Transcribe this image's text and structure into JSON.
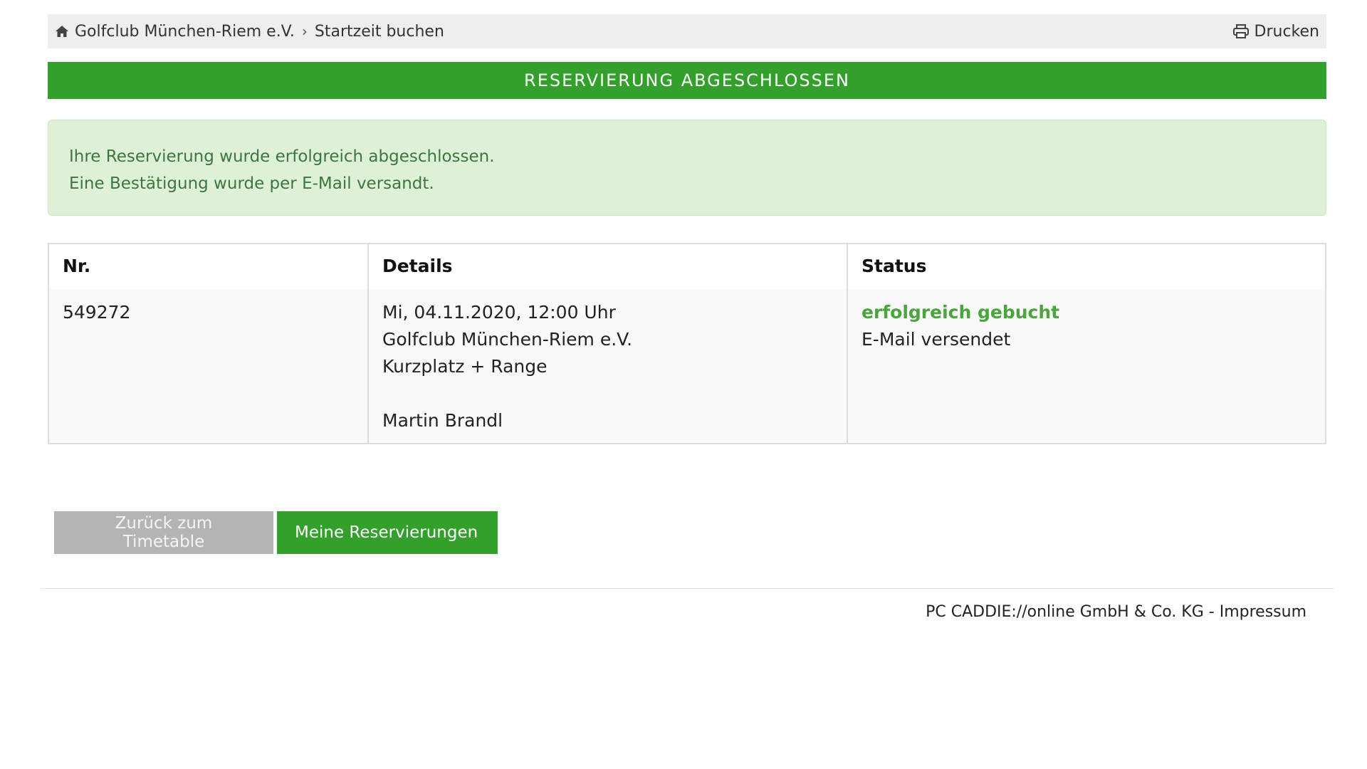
{
  "breadcrumb": {
    "home_icon": "home-icon",
    "club": "Golfclub München-Riem e.V.",
    "separator_icon": "chevron-right-icon",
    "current": "Startzeit buchen",
    "print_icon": "print-icon",
    "print_label": "Drucken"
  },
  "title": "Reservierung abgeschlossen",
  "alert": {
    "line1": "Ihre Reservierung wurde erfolgreich abgeschlossen.",
    "line2": "Eine Bestätigung wurde per E-Mail versandt."
  },
  "table": {
    "headers": [
      "Nr.",
      "Details",
      "Status"
    ],
    "rows": [
      {
        "nr": "549272",
        "details": {
          "datetime": "Mi, 04.11.2020, 12:00 Uhr",
          "club": "Golfclub München-Riem e.V.",
          "course": "Kurzplatz + Range",
          "player": "Martin Brandl"
        },
        "status": {
          "booking": "erfolgreich gebucht",
          "mail": "E-Mail versendet"
        }
      }
    ]
  },
  "buttons": {
    "back": "Zurück zum Timetable",
    "my_reservations": "Meine Reservierungen"
  },
  "footer": {
    "company": "PC CADDIE://online GmbH & Co. KG",
    "separator": "-",
    "impressum": "Impressum"
  },
  "colors": {
    "accent_green": "#33a02c",
    "alert_bg": "#dff0d8",
    "alert_text": "#3c763d",
    "status_green": "#4aa63c",
    "button_grey": "#b4b4b4"
  }
}
